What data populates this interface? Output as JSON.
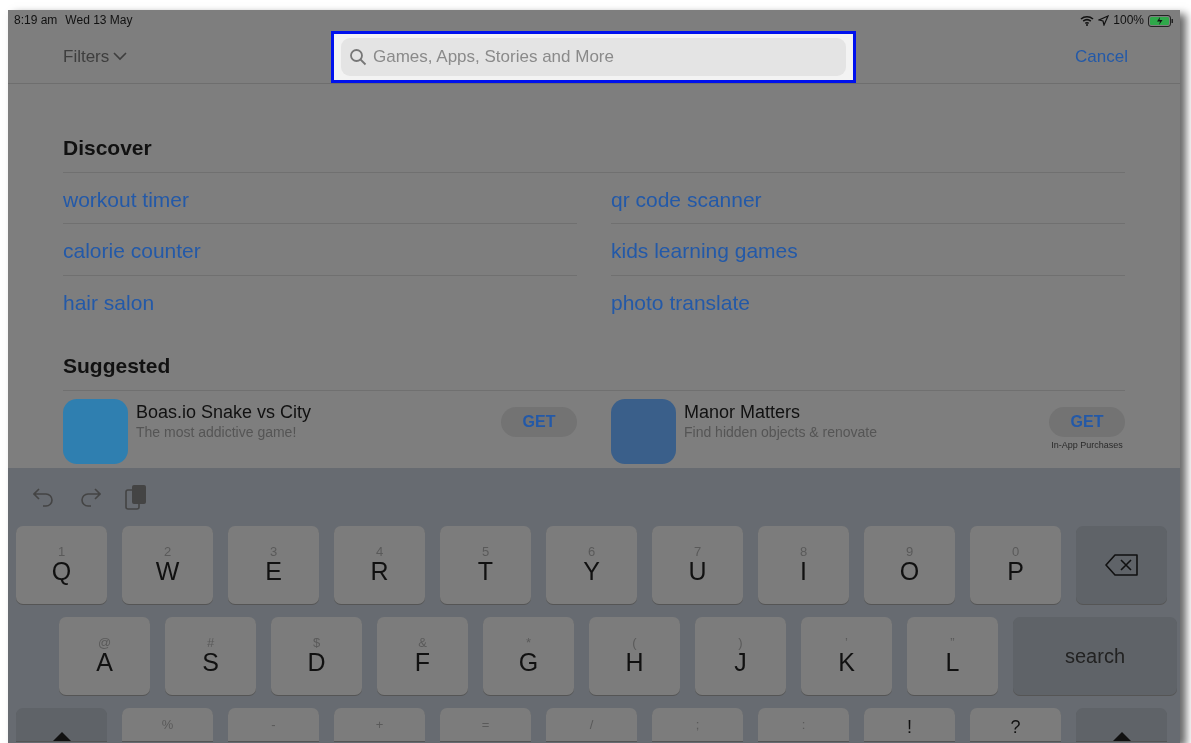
{
  "status_bar": {
    "time": "8:19 am",
    "date": "Wed 13 May",
    "battery": "100%",
    "charging": true
  },
  "nav": {
    "filters": "Filters",
    "search": {
      "placeholder": "Games, Apps, Stories and More",
      "highlighted": true
    },
    "cancel": "Cancel"
  },
  "discover": {
    "title": "Discover",
    "items": [
      "workout timer",
      "qr code scanner",
      "calorie counter",
      "kids learning games",
      "hair salon",
      "photo translate"
    ]
  },
  "suggested": {
    "title": "Suggested",
    "apps": [
      {
        "name": "Boas.io Snake vs City",
        "subtitle": "The most addictive game!",
        "button": "GET",
        "color": "#2f7fb0"
      },
      {
        "name": "Manor Matters",
        "subtitle": "Find hidden objects & renovate",
        "button": "GET",
        "note": "In-App Purchases",
        "color": "#3a5f8a"
      }
    ]
  },
  "keyboard": {
    "rows": [
      [
        {
          "kind": "letter",
          "main": "Q",
          "alt": "1"
        },
        {
          "kind": "letter",
          "main": "W",
          "alt": "2"
        },
        {
          "kind": "letter",
          "main": "E",
          "alt": "3"
        },
        {
          "kind": "letter",
          "main": "R",
          "alt": "4"
        },
        {
          "kind": "letter",
          "main": "T",
          "alt": "5"
        },
        {
          "kind": "letter",
          "main": "Y",
          "alt": "6"
        },
        {
          "kind": "letter",
          "main": "U",
          "alt": "7"
        },
        {
          "kind": "letter",
          "main": "I",
          "alt": "8"
        },
        {
          "kind": "letter",
          "main": "O",
          "alt": "9"
        },
        {
          "kind": "letter",
          "main": "P",
          "alt": "0"
        },
        {
          "kind": "backspace"
        }
      ],
      [
        {
          "kind": "letter",
          "main": "A",
          "alt": "@"
        },
        {
          "kind": "letter",
          "main": "S",
          "alt": "#"
        },
        {
          "kind": "letter",
          "main": "D",
          "alt": "$"
        },
        {
          "kind": "letter",
          "main": "F",
          "alt": "&"
        },
        {
          "kind": "letter",
          "main": "G",
          "alt": "*"
        },
        {
          "kind": "letter",
          "main": "H",
          "alt": "("
        },
        {
          "kind": "letter",
          "main": "J",
          "alt": ")"
        },
        {
          "kind": "letter",
          "main": "K",
          "alt": "’"
        },
        {
          "kind": "letter",
          "main": "L",
          "alt": "”"
        },
        {
          "kind": "search",
          "main": "search"
        }
      ],
      [
        {
          "kind": "shift"
        },
        {
          "kind": "letter",
          "alt": "%"
        },
        {
          "kind": "letter",
          "alt": "-"
        },
        {
          "kind": "letter",
          "alt": "+"
        },
        {
          "kind": "letter",
          "alt": "="
        },
        {
          "kind": "letter",
          "alt": "/"
        },
        {
          "kind": "letter",
          "alt": ";"
        },
        {
          "kind": "letter",
          "alt": ":"
        },
        {
          "kind": "letter",
          "main": "!"
        },
        {
          "kind": "letter",
          "main": "?"
        },
        {
          "kind": "shift"
        }
      ]
    ]
  }
}
